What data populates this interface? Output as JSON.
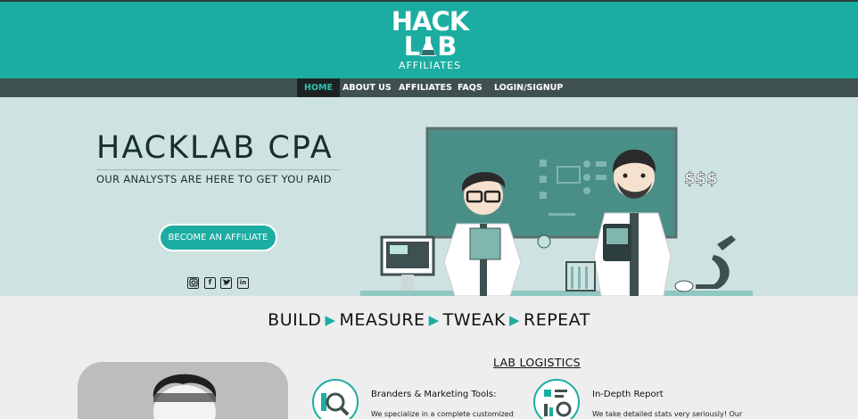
{
  "logo": {
    "line1": "HACK",
    "line2_prefix": "L",
    "line2_suffix": "B",
    "subtitle": "AFFILIATES"
  },
  "nav": {
    "items": [
      {
        "label": "HOME",
        "active": true
      },
      {
        "label": "ABOUT US",
        "active": false
      },
      {
        "label": "AFFILIATES",
        "active": false
      },
      {
        "label": "FAQS",
        "active": false
      },
      {
        "label": "LOGIN/SIGNUP",
        "active": false
      }
    ]
  },
  "hero": {
    "title": "HACKLAB CPA",
    "subtitle": "OUR ANALYSTS ARE HERE TO GET YOU PAID",
    "cta_label": "BECOME AN AFFILIATE",
    "money_sign": "$$$",
    "social": [
      "instagram-icon",
      "facebook-icon",
      "twitter-icon",
      "linkedin-icon"
    ]
  },
  "tagline": {
    "words": [
      "BUILD",
      "MEASURE",
      "TWEAK",
      "REPEAT"
    ],
    "separator_icon": "play-triangle-icon"
  },
  "logistics": {
    "title": "LAB LOGISTICS",
    "features": [
      {
        "title": "Branders & Marketing Tools:",
        "text": "We specialize in a complete customized",
        "icon": "magnifier-chart-icon"
      },
      {
        "title": "In-Depth Report",
        "text": "We take detailed stats very seriously! Our",
        "icon": "report-chart-icon"
      }
    ]
  },
  "colors": {
    "brand": "#1bada1",
    "nav_bg": "#3e504f",
    "nav_active": "#1c2222",
    "hero_bg": "#cfe2e2",
    "text_dark": "#15302f"
  }
}
